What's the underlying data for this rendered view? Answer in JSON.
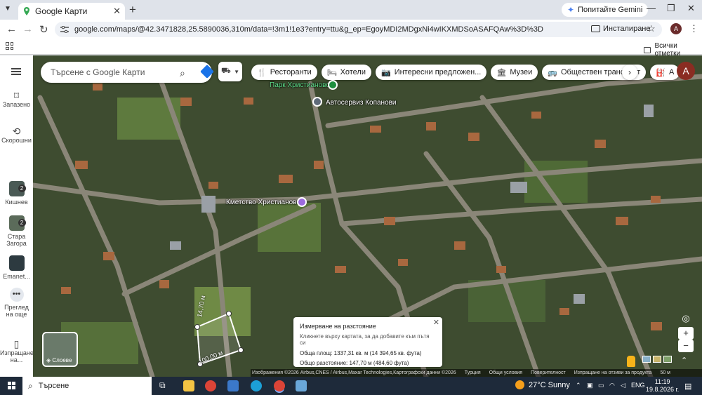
{
  "browser": {
    "tab_title": "Google Карти",
    "url": "google.com/maps/@42.3471828,25.5890036,310m/data=!3m1!1e3?entry=ttu&g_ep=EgoyMDI2MDgxNi4wIKXMDSoASAFQAw%3D%3D",
    "gemini_label": "Попитайте Gemini",
    "install_label": "Инсталиране",
    "profile_initial": "A",
    "all_bookmarks": "Всички отметки"
  },
  "rail": {
    "saved": "Запазено",
    "recent": "Скорошни",
    "items": [
      {
        "label": "Кишнев",
        "count": "2"
      },
      {
        "label": "Стара Загора",
        "count": "2"
      },
      {
        "label": "Emanet..."
      }
    ],
    "more_label": "Преглед на още",
    "export_label": "Изпращане на..."
  },
  "map": {
    "search_placeholder": "Търсене с Google Карти",
    "chips": [
      {
        "icon": "restaurant-icon",
        "glyph": "🍴",
        "label": "Ресторанти"
      },
      {
        "icon": "hotel-icon",
        "glyph": "🛏",
        "label": "Хотели"
      },
      {
        "icon": "camera-icon",
        "glyph": "📷",
        "label": "Интересни предложен..."
      },
      {
        "icon": "museum-icon",
        "glyph": "🏛",
        "label": "Музеи"
      },
      {
        "icon": "transit-icon",
        "glyph": "🚌",
        "label": "Обществен транспорт"
      },
      {
        "icon": "more-icon",
        "glyph": "⛽",
        "label": "А"
      }
    ],
    "account_initial": "A",
    "places": {
      "park": "Парк Христианово",
      "service": "Автосервиз Копанови",
      "town_hall": "Кметство Христианово"
    },
    "measure": {
      "side_a": "14,70 м",
      "side_b": "100,00 м",
      "card_title": "Измерване на разстояние",
      "card_hint": "Кликнете върху картата, за да добавите към пътя си",
      "area": "Обща площ: 1337,31 кв. м (14 394,65 кв. фута)",
      "distance": "Общо разстояние: 147,70 м (484,60 фута)"
    },
    "layers_label": "Слоеве",
    "footer": {
      "attribution": "Изображения ©2026 Airbus,CNES / Airbus,Maxar Technologies,Картографски данни ©2026",
      "links": [
        "Турция",
        "Общи условия",
        "Поверителност",
        "Изпращане на отзиви за продукта"
      ],
      "scale": "50 м"
    }
  },
  "taskbar": {
    "search_label": "Търсене",
    "temperature": "27°C",
    "weather": "Sunny",
    "lang": "ENG",
    "time": "11:19",
    "date": "19.8.2026 г."
  }
}
